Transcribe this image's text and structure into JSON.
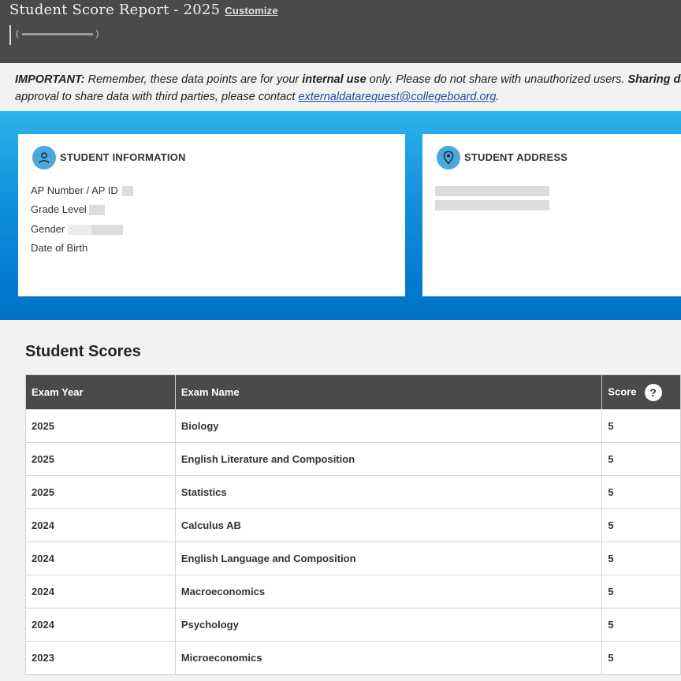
{
  "header": {
    "title": "Student Score Report - 2025",
    "customize_label": "Customize"
  },
  "notice": {
    "important_label": "IMPORTANT:",
    "text1": " Remember, these data points are for your ",
    "internal_use": "internal use",
    "text2": " only. Please do not share with unauthorized users. ",
    "sharing": "Sharing da",
    "line2": "approval to share data with third parties, please contact ",
    "email": "externaldatarequest@collegeboard.org",
    "period": "."
  },
  "student_info": {
    "title": "STUDENT INFORMATION",
    "icon": "person-icon",
    "ap_number_label": "AP Number / AP ID",
    "grade_label": "Grade Level",
    "gender_label": "Gender",
    "dob_label": "Date of Birth"
  },
  "student_address": {
    "title": "STUDENT ADDRESS",
    "icon": "location-pin-icon"
  },
  "scores": {
    "title": "Student Scores",
    "columns": [
      "Exam Year",
      "Exam Name",
      "Score"
    ],
    "rows": [
      {
        "year": "2025",
        "name": "Biology",
        "score": "5"
      },
      {
        "year": "2025",
        "name": "English Literature and Composition",
        "score": "5"
      },
      {
        "year": "2025",
        "name": "Statistics",
        "score": "5"
      },
      {
        "year": "2024",
        "name": "Calculus AB",
        "score": "5"
      },
      {
        "year": "2024",
        "name": "English Language and Composition",
        "score": "5"
      },
      {
        "year": "2024",
        "name": "Macroeconomics",
        "score": "5"
      },
      {
        "year": "2024",
        "name": "Psychology",
        "score": "5"
      },
      {
        "year": "2023",
        "name": "Microeconomics",
        "score": "5"
      }
    ]
  },
  "colors": {
    "header_bg": "#4a4a4a",
    "band_top": "#2bb3ea",
    "band_bottom": "#0071c8",
    "icon_circle": "#4aa8dc",
    "link": "#1f4fa6"
  }
}
